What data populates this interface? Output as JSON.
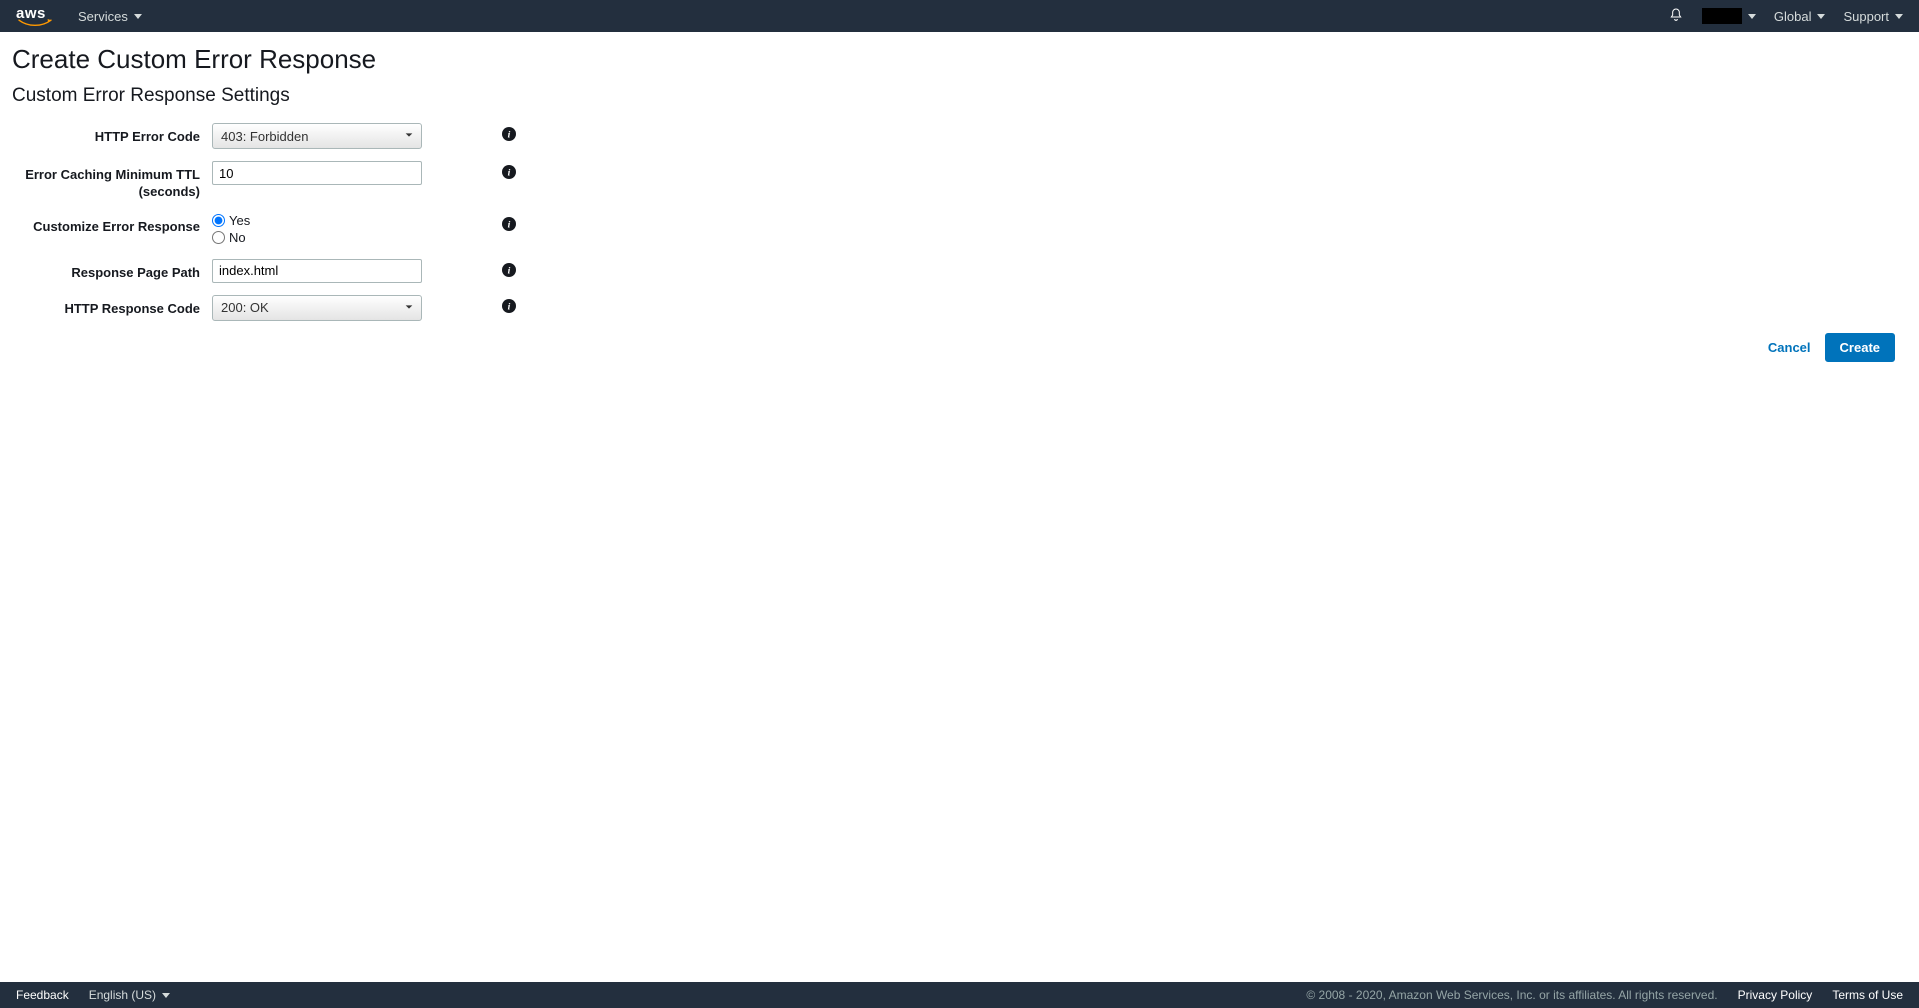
{
  "header": {
    "services_label": "Services",
    "global_label": "Global",
    "support_label": "Support"
  },
  "page": {
    "title": "Create Custom Error Response",
    "section_title": "Custom Error Response Settings"
  },
  "form": {
    "http_error_code": {
      "label": "HTTP Error Code",
      "value": "403: Forbidden"
    },
    "caching_ttl": {
      "label": "Error Caching Minimum TTL (seconds)",
      "value": "10"
    },
    "customize": {
      "label": "Customize Error Response",
      "yes": "Yes",
      "no": "No",
      "selected": "yes"
    },
    "response_page_path": {
      "label": "Response Page Path",
      "value": "index.html"
    },
    "http_response_code": {
      "label": "HTTP Response Code",
      "value": "200: OK"
    }
  },
  "actions": {
    "cancel": "Cancel",
    "create": "Create"
  },
  "footer": {
    "feedback": "Feedback",
    "language": "English (US)",
    "copyright": "© 2008 - 2020, Amazon Web Services, Inc. or its affiliates. All rights reserved.",
    "privacy": "Privacy Policy",
    "terms": "Terms of Use"
  }
}
